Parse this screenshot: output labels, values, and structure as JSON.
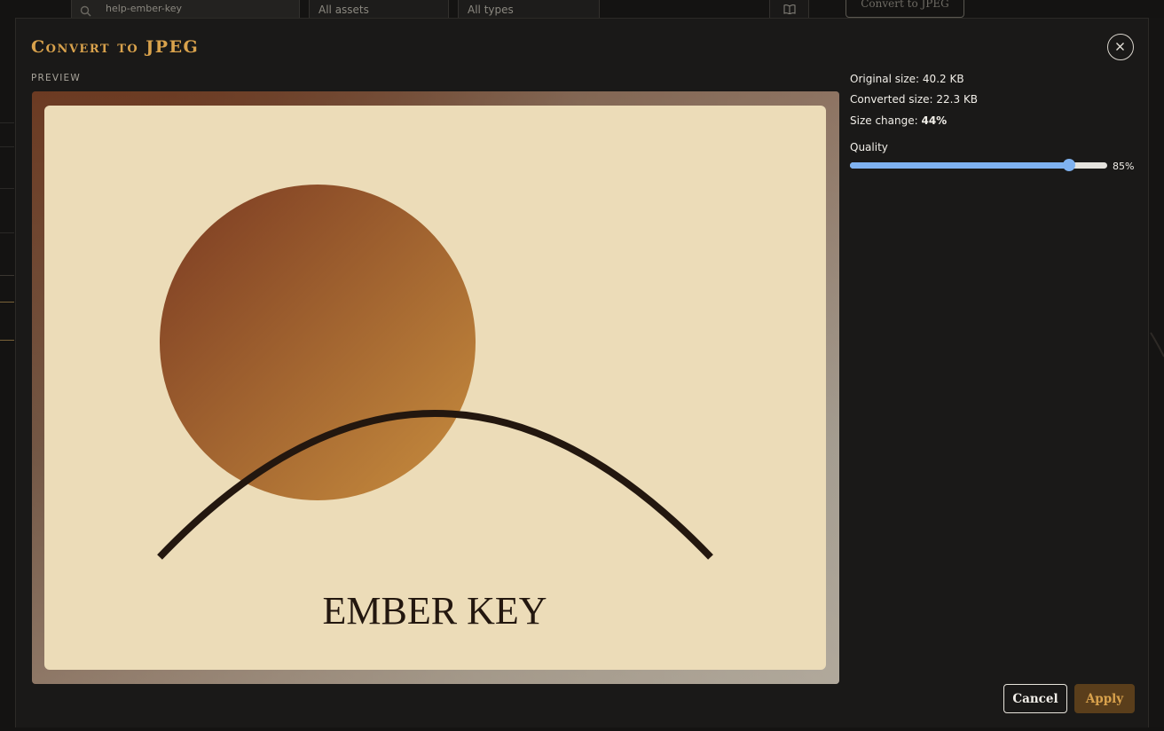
{
  "background": {
    "search": {
      "value": "help-ember-key"
    },
    "asset_filter": "All assets",
    "type_filter": "All types",
    "convert_button": "Convert to JPEG"
  },
  "modal": {
    "title": "Convert to JPEG",
    "preview_label": "PREVIEW",
    "close_icon": "close-icon",
    "preview_image": {
      "caption": "EMBER KEY",
      "colors": {
        "paper": "#ecdcb8",
        "sun_start": "#7a3a22",
        "sun_end": "#c98e3e",
        "arc": "#23170f"
      }
    },
    "info": {
      "original_label": "Original size:",
      "original_value": "40.2 KB",
      "converted_label": "Converted size:",
      "converted_value": "22.3 KB",
      "change_label": "Size change:",
      "change_value": "44%"
    },
    "quality": {
      "label": "Quality",
      "value": 85,
      "display": "85%"
    },
    "buttons": {
      "cancel": "Cancel",
      "apply": "Apply"
    }
  },
  "colors": {
    "accent": "#d9a24c",
    "slider": "#7fb2f0",
    "apply_bg": "#5a3e1b"
  }
}
